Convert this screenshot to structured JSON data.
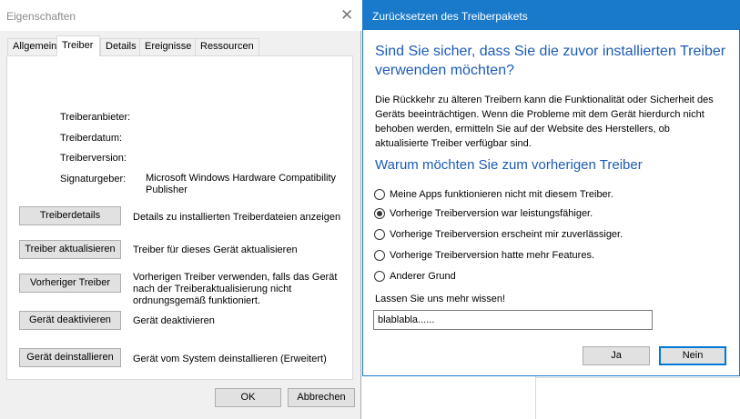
{
  "properties_window": {
    "title": "Eigenschaften",
    "close_glyph": "✕",
    "tabs": [
      "Allgemein",
      "Treiber",
      "Details",
      "Ereignisse",
      "Ressourcen"
    ],
    "active_tab": "Treiber",
    "fields": {
      "provider_label": "Treiberanbieter:",
      "date_label": "Treiberdatum:",
      "version_label": "Treiberversion:",
      "signer_label": "Signaturgeber:",
      "signer_value": "Microsoft Windows Hardware Compatibility Publisher"
    },
    "actions": [
      {
        "button": "Treiberdetails",
        "description": "Details zu installierten Treiberdateien anzeigen"
      },
      {
        "button": "Treiber aktualisieren",
        "description": "Treiber für dieses Gerät aktualisieren"
      },
      {
        "button": "Vorheriger Treiber",
        "description": "Vorherigen Treiber verwenden, falls das Gerät nach der Treiberaktualisierung nicht ordnungsgemäß funktioniert."
      },
      {
        "button": "Gerät deaktivieren",
        "description": "Gerät deaktivieren"
      },
      {
        "button": "Gerät deinstallieren",
        "description": "Gerät vom System deinstallieren (Erweitert)"
      }
    ],
    "ok_label": "OK",
    "cancel_label": "Abbrechen"
  },
  "rollback_dialog": {
    "title": "Zurücksetzen des Treiberpakets",
    "heading": "Sind Sie sicher, dass Sie die zuvor installierten Treiber verwenden möchten?",
    "paragraph": "Die Rückkehr zu älteren Treibern kann die Funktionalität oder Sicherheit des Geräts beeinträchtigen. Wenn die Probleme mit dem Gerät hierdurch nicht behoben werden, ermitteln Sie auf der Website des Herstellers, ob aktualisierte Treiber verfügbar sind.",
    "question": "Warum möchten Sie zum vorherigen Treiber",
    "reasons": [
      "Meine Apps funktionieren nicht mit diesem Treiber.",
      "Vorherige Treiberversion war leistungsfähiger.",
      "Vorherige Treiberversion erscheint mir zuverlässiger.",
      "Vorherige Treiberversion hatte mehr Features.",
      "Anderer Grund"
    ],
    "selected_reason": "Vorherige Treiberversion war leistungsfähiger.",
    "more_label": "Lassen Sie uns mehr wissen!",
    "more_value": "blablabla......",
    "yes_label": "Ja",
    "no_label": "Nein"
  },
  "colors": {
    "accent": "#1979ca",
    "heading": "#1c5bb5",
    "window_bg": "#f0f0f0",
    "button_bg": "#e1e1e1"
  }
}
